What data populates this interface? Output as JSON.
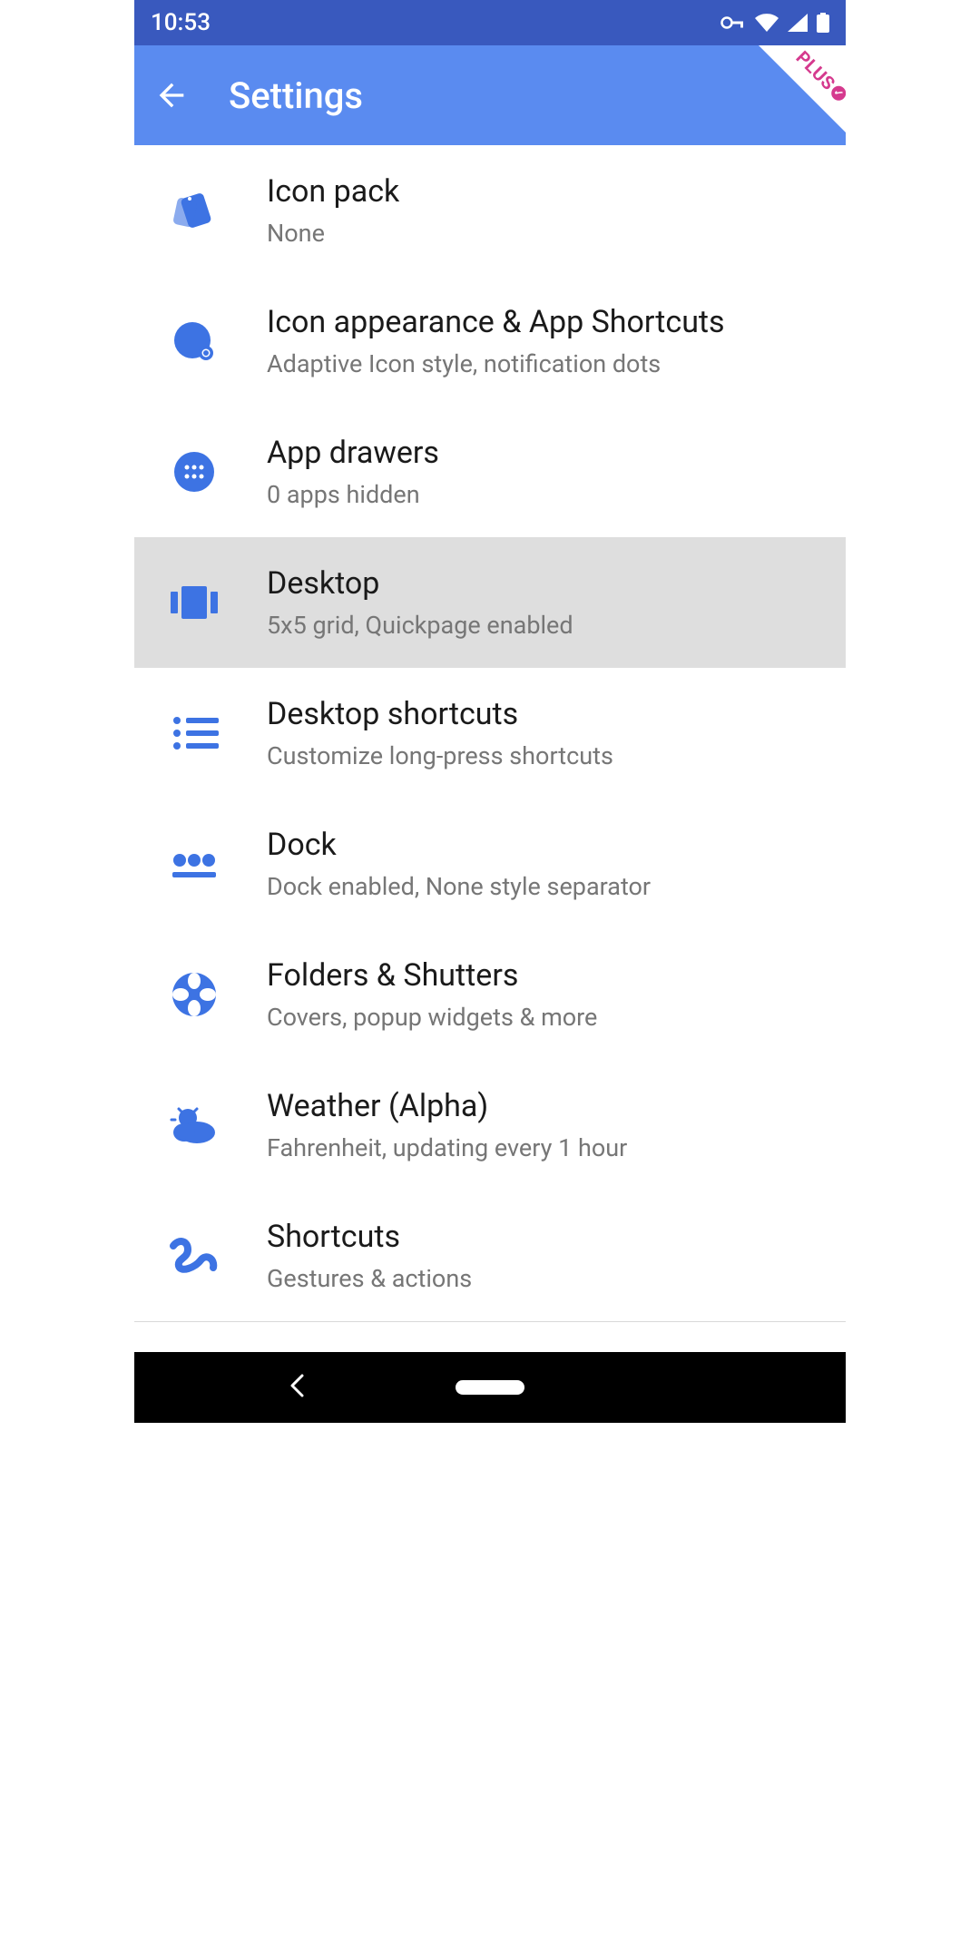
{
  "status": {
    "time": "10:53"
  },
  "header": {
    "title": "Settings",
    "plus_label": "PLUS"
  },
  "items": [
    {
      "title": "Icon pack",
      "sub": "None",
      "icon": "icon-pack",
      "selected": false
    },
    {
      "title": "Icon appearance & App Shortcuts",
      "sub": "Adaptive Icon style, notification dots",
      "icon": "icon-appearance",
      "selected": false
    },
    {
      "title": "App drawers",
      "sub": "0 apps hidden",
      "icon": "app-drawers",
      "selected": false
    },
    {
      "title": "Desktop",
      "sub": "5x5 grid, Quickpage enabled",
      "icon": "desktop",
      "selected": true
    },
    {
      "title": "Desktop shortcuts",
      "sub": "Customize long-press shortcuts",
      "icon": "desktop-shortcuts",
      "selected": false
    },
    {
      "title": "Dock",
      "sub": "Dock enabled, None style separator",
      "icon": "dock",
      "selected": false
    },
    {
      "title": "Folders & Shutters",
      "sub": "Covers, popup widgets & more",
      "icon": "folders",
      "selected": false
    },
    {
      "title": "Weather (Alpha)",
      "sub": "Fahrenheit, updating every 1 hour",
      "icon": "weather",
      "selected": false
    },
    {
      "title": "Shortcuts",
      "sub": "Gestures & actions",
      "icon": "shortcuts",
      "selected": false
    }
  ]
}
